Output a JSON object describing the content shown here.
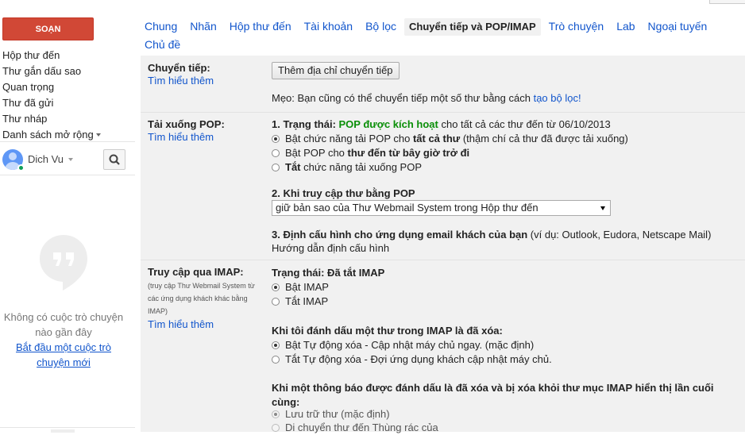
{
  "compose_label": "SOẠN",
  "nav": {
    "inbox": "Hộp thư đến",
    "starred": "Thư gắn dấu sao",
    "important": "Quan trọng",
    "sent": "Thư đã gửi",
    "drafts": "Thư nháp",
    "more": "Danh sách mở rộng"
  },
  "chat": {
    "user_name": "Dich Vu",
    "empty_text": "Không có cuộc trò chuyện nào gần đây",
    "start_link": "Bắt đầu một cuộc trò chuyện mới"
  },
  "tabs": [
    "Chung",
    "Nhãn",
    "Hộp thư đến",
    "Tài khoản",
    "Bộ lọc",
    "Chuyển tiếp và POP/IMAP",
    "Trò chuyện",
    "Lab",
    "Ngoại tuyến",
    "Chủ đề"
  ],
  "active_tab": "Chuyển tiếp và POP/IMAP",
  "forwarding": {
    "label": "Chuyển tiếp:",
    "learn_more": "Tìm hiểu thêm",
    "add_button": "Thêm địa chỉ chuyển tiếp",
    "tip_prefix": "Mẹo: Bạn cũng có thể chuyển tiếp một số thư bằng cách ",
    "tip_link": "tạo bộ lọc!"
  },
  "pop": {
    "label": "Tải xuống POP:",
    "learn_more": "Tìm hiểu thêm",
    "status_prefix": "1. Trạng thái: ",
    "status_value": "POP được kích hoạt",
    "status_suffix": " cho tất cả các thư đến từ 06/10/2013",
    "option1_a": "Bật chức năng tải POP cho ",
    "option1_b": "tất cả thư",
    "option1_c": " (thậm chí cả thư đã được tải xuống)",
    "option2_a": "Bật POP cho ",
    "option2_b": "thư đến từ bây giờ trở đi",
    "option3_a": "Tắt",
    "option3_b": " chức năng tải xuống POP",
    "access_heading": "2. Khi truy cập thư bằng POP",
    "access_selected": "giữ bản sao của Thư Webmail System trong Hộp thư đến",
    "config_heading": "3. Định cấu hình cho ứng dụng email khách của bạn",
    "config_example": " (ví dụ: Outlook, Eudora, Netscape Mail)",
    "config_link": "Hướng dẫn định cấu hình"
  },
  "imap": {
    "label": "Truy cập qua IMAP:",
    "sub": "(truy cập Thư Webmail System từ các ứng dụng khách khác bằng IMAP)",
    "learn_more": "Tìm hiểu thêm",
    "status": "Trạng thái: Đã tắt IMAP",
    "enable": "Bật IMAP",
    "disable": "Tắt IMAP",
    "delete_heading": "Khi tôi đánh dấu một thư trong IMAP là đã xóa:",
    "auto_on": "Bật Tự động xóa - Cập nhật máy chủ ngay. (mặc định)",
    "auto_off": "Tắt Tự động xóa - Đợi ứng dụng khách cập nhật máy chủ.",
    "expunge_heading": "Khi một thông báo được đánh dấu là đã xóa và bị xóa khỏi thư mục IMAP hiển thị lần cuối cùng:",
    "archive": "Lưu trữ thư (mặc định)",
    "trash": "Di chuyển thư đến Thùng rác của"
  }
}
